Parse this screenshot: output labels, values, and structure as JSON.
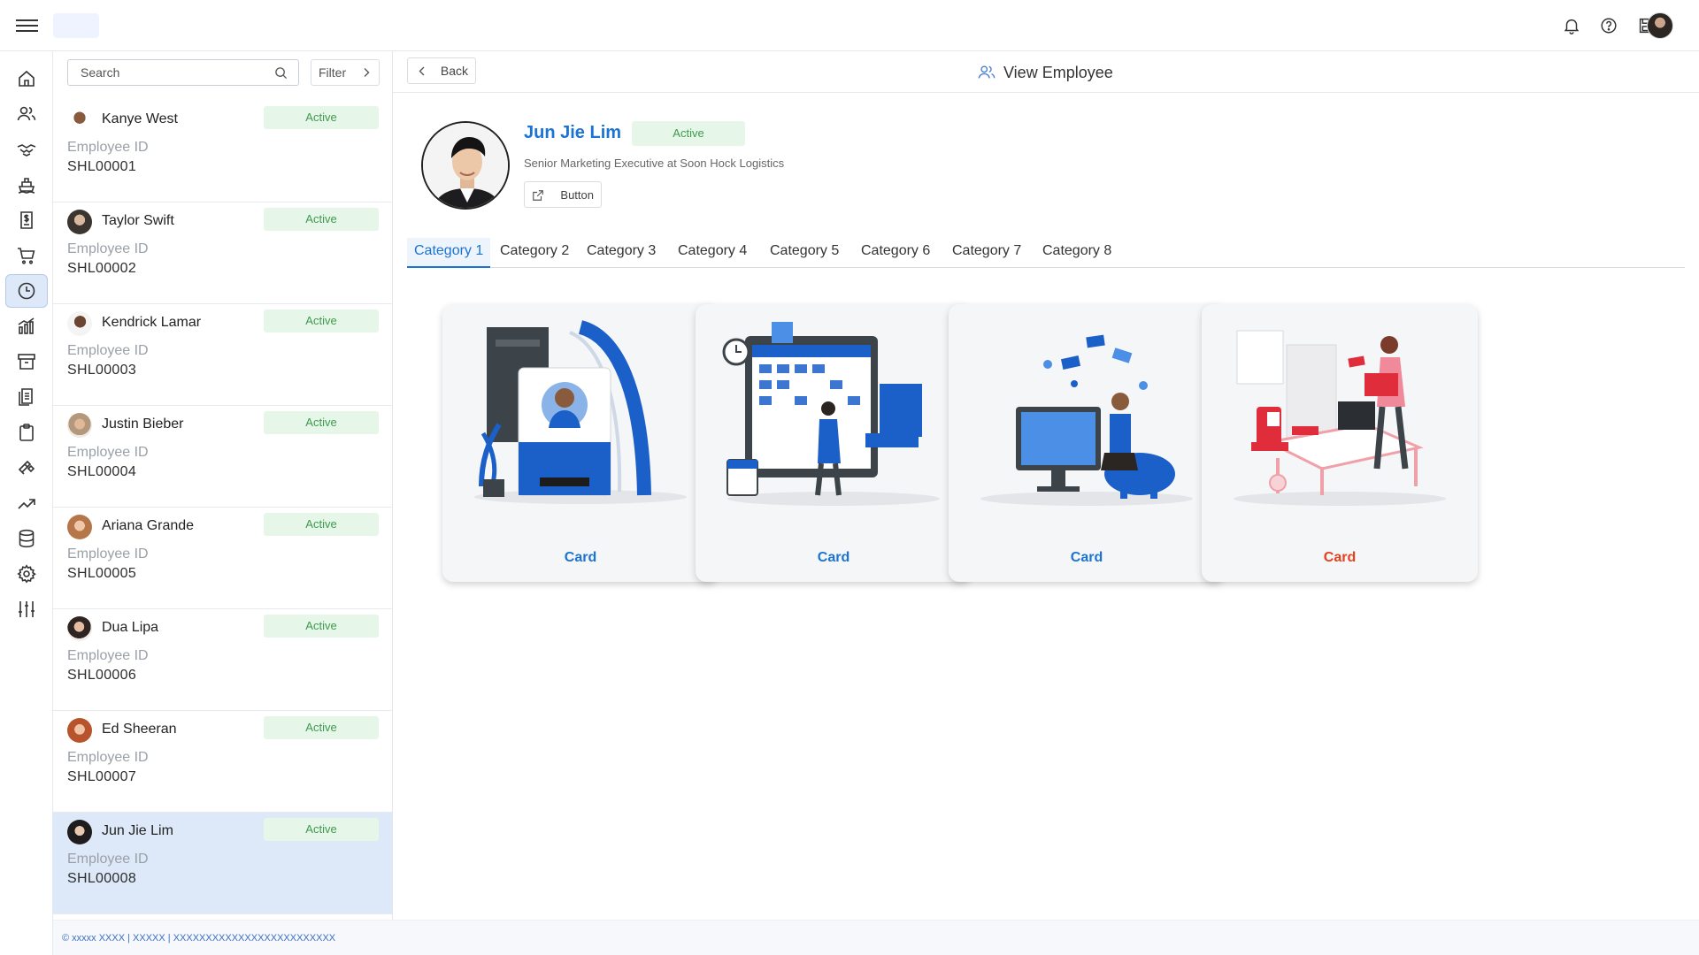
{
  "topbar": {
    "icons": [
      "menu-icon",
      "bell-icon",
      "help-icon",
      "save-icon"
    ],
    "avatar": "user-avatar"
  },
  "rail": {
    "items": [
      {
        "icon": "home-icon"
      },
      {
        "icon": "users-icon"
      },
      {
        "icon": "handshake-icon"
      },
      {
        "icon": "ship-icon"
      },
      {
        "icon": "invoice-icon"
      },
      {
        "icon": "cart-icon"
      },
      {
        "icon": "clock-icon",
        "active": true
      },
      {
        "icon": "bar-chart-icon"
      },
      {
        "icon": "archive-icon"
      },
      {
        "icon": "documents-icon"
      },
      {
        "icon": "clipboard-icon"
      },
      {
        "icon": "tools-icon"
      },
      {
        "icon": "trend-icon"
      },
      {
        "icon": "database-icon"
      },
      {
        "icon": "gear-icon"
      },
      {
        "icon": "sliders-icon"
      }
    ]
  },
  "list": {
    "search_placeholder": "Search",
    "filter_label": "Filter",
    "id_label": "Employee ID",
    "employees": [
      {
        "name": "Kanye West",
        "status": "Active",
        "id": "SHL00001"
      },
      {
        "name": "Taylor Swift",
        "status": "Active",
        "id": "SHL00002"
      },
      {
        "name": "Kendrick Lamar",
        "status": "Active",
        "id": "SHL00003"
      },
      {
        "name": "Justin Bieber",
        "status": "Active",
        "id": "SHL00004"
      },
      {
        "name": "Ariana Grande",
        "status": "Active",
        "id": "SHL00005"
      },
      {
        "name": "Dua Lipa",
        "status": "Active",
        "id": "SHL00006"
      },
      {
        "name": "Ed Sheeran",
        "status": "Active",
        "id": "SHL00007"
      },
      {
        "name": "Jun Jie Lim",
        "status": "Active",
        "id": "SHL00008",
        "selected": true
      }
    ]
  },
  "main": {
    "back_label": "Back",
    "page_title": "View Employee",
    "profile": {
      "name": "Jun Jie Lim",
      "status": "Active",
      "title": "Senior Marketing Executive at Soon Hock Logistics",
      "button_label": "Button"
    },
    "tabs": [
      "Category 1",
      "Category 2",
      "Category 3",
      "Category 4",
      "Category 5",
      "Category 6",
      "Category 7",
      "Category 8"
    ],
    "active_tab": 0,
    "cards": [
      {
        "label": "Card",
        "illustration": "id-badge-illustration",
        "accent": "#1b73d3"
      },
      {
        "label": "Card",
        "illustration": "calendar-schedule-illustration",
        "accent": "#1b73d3"
      },
      {
        "label": "Card",
        "illustration": "income-savings-illustration",
        "accent": "#1b73d3"
      },
      {
        "label": "Card",
        "illustration": "office-leaving-illustration",
        "accent": "#e5401f"
      }
    ]
  },
  "footer": {
    "text": "© xxxxx XXXX | XXXXX | XXXXXXXXXXXXXXXXXXXXXXXXX"
  },
  "colors": {
    "primary": "#1b73d3",
    "active_badge_bg": "#e6f6e8",
    "active_badge_text": "#3f9a4e",
    "selected_row_bg": "#dde8f9",
    "card_alert": "#e5401f"
  }
}
